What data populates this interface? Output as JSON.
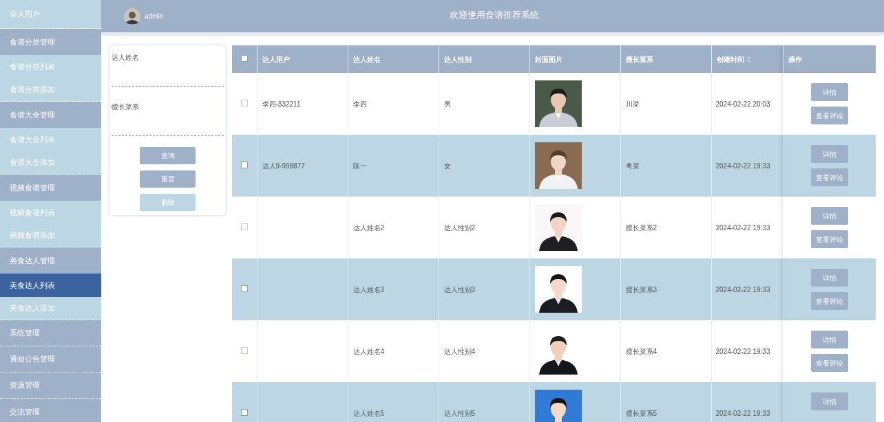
{
  "sidebar": {
    "items": [
      {
        "label": "达人用户",
        "kind": "item",
        "selected": false
      },
      {
        "label": "食谱分类管理",
        "kind": "group",
        "selected": false
      },
      {
        "label": "食谱分类列表",
        "kind": "item",
        "selected": false
      },
      {
        "label": "食谱分类添加",
        "kind": "item",
        "selected": false
      },
      {
        "label": "食谱大全管理",
        "kind": "group",
        "selected": false
      },
      {
        "label": "食谱大全列表",
        "kind": "item",
        "selected": false
      },
      {
        "label": "食谱大全添加",
        "kind": "item",
        "selected": false
      },
      {
        "label": "视频食谱管理",
        "kind": "group",
        "selected": false
      },
      {
        "label": "视频食谱列表",
        "kind": "item",
        "selected": false
      },
      {
        "label": "视频食谱添加",
        "kind": "item",
        "selected": false
      },
      {
        "label": "美食达人管理",
        "kind": "group",
        "selected": false
      },
      {
        "label": "美食达人列表",
        "kind": "item",
        "selected": true
      },
      {
        "label": "美食达人添加",
        "kind": "item",
        "selected": false
      },
      {
        "label": "系统管理",
        "kind": "group",
        "selected": false
      },
      {
        "label": "通知公告管理",
        "kind": "group",
        "selected": false
      },
      {
        "label": "资源管理",
        "kind": "group",
        "selected": false
      },
      {
        "label": "交流管理",
        "kind": "group",
        "selected": false
      }
    ]
  },
  "header": {
    "user": "admin",
    "title": "欢迎使用食谱推荐系统"
  },
  "search": {
    "fields": [
      {
        "label": "达人姓名"
      },
      {
        "label": "擅长菜系"
      }
    ],
    "buttons": [
      {
        "label": "查询",
        "disabled": false
      },
      {
        "label": "重置",
        "disabled": false
      },
      {
        "label": "删除",
        "disabled": true
      }
    ]
  },
  "table": {
    "select_all": {
      "checked": false
    },
    "columns": [
      {
        "label": "达人用户",
        "sortable": false
      },
      {
        "label": "达人姓名",
        "sortable": false
      },
      {
        "label": "达人性别",
        "sortable": false
      },
      {
        "label": "封面图片",
        "sortable": false
      },
      {
        "label": "擅长菜系",
        "sortable": false
      },
      {
        "label": "创建时间",
        "sortable": true
      },
      {
        "label": "操作",
        "sortable": false
      }
    ],
    "rows": [
      {
        "checked": false,
        "user": "李四-332211",
        "name": "李四",
        "gender": "男",
        "cover": {
          "kind": "picture"
        },
        "cuisine": "川菜",
        "created": "2024-02-22 20:03",
        "actions": [
          "详情",
          "查看评论"
        ]
      },
      {
        "checked": false,
        "user": "达人9-998877",
        "name": "陈一",
        "gender": "女",
        "cover": {
          "kind": "picture"
        },
        "cuisine": "粤菜",
        "created": "2024-02-22 19:33",
        "actions": [
          "详情",
          "查看评论"
        ]
      },
      {
        "checked": false,
        "user": "",
        "name": "达人姓名2",
        "gender": "达人性别2",
        "cover": {
          "kind": "picture"
        },
        "cuisine": "擅长菜系2",
        "created": "2024-02-22 19:33",
        "actions": [
          "详情",
          "查看评论"
        ]
      },
      {
        "checked": false,
        "user": "",
        "name": "达人姓名3",
        "gender": "达人性别3",
        "cover": {
          "kind": "picture"
        },
        "cuisine": "擅长菜系3",
        "created": "2024-02-22 19:33",
        "actions": [
          "详情",
          "查看评论"
        ]
      },
      {
        "checked": false,
        "user": "",
        "name": "达人姓名4",
        "gender": "达人性别4",
        "cover": {
          "kind": "picture"
        },
        "cuisine": "擅长菜系4",
        "created": "2024-02-22 19:33",
        "actions": [
          "详情",
          "查看评论"
        ]
      },
      {
        "checked": false,
        "user": "",
        "name": "达人姓名5",
        "gender": "达人性别5",
        "cover": {
          "kind": "picture"
        },
        "cuisine": "擅长菜系5",
        "created": "2024-02-22 19:33",
        "actions": [
          "详情"
        ]
      }
    ]
  }
}
